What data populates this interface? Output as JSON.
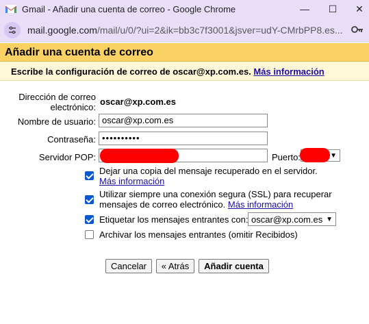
{
  "window": {
    "title": "Gmail - Añadir una cuenta de correo - Google Chrome",
    "minimize": "—",
    "maximize": "☐",
    "close": "✕"
  },
  "address_bar": {
    "host": "mail.google.com",
    "path": "/mail/u/0/?ui=2&ik=bb3c7f3001&jsver=udY-CMrbPP8.es..."
  },
  "dialog": {
    "title": "Añadir una cuenta de correo",
    "subtitle": "Escribe la configuración de correo de oscar@xp.com.es.",
    "more_info": "Más información"
  },
  "form": {
    "email_label": "Dirección de correo electrónico:",
    "email_value": "oscar@xp.com.es",
    "username_label": "Nombre de usuario:",
    "username_value": "oscar@xp.com.es",
    "password_label": "Contraseña:",
    "password_value": "••••••••••",
    "pop_label": "Servidor POP:",
    "port_label": "Puerto:",
    "opt_copy": "Dejar una copia del mensaje recuperado en el servidor.",
    "opt_copy_link": "Más información",
    "opt_ssl": "Utilizar siempre una conexión segura (SSL) para recuperar mensajes de correo electrónico.",
    "opt_ssl_link": "Más información",
    "opt_label": "Etiquetar los mensajes entrantes con:",
    "opt_label_value": "oscar@xp.com.es",
    "opt_archive": "Archivar los mensajes entrantes (omitir Recibidos)"
  },
  "buttons": {
    "cancel": "Cancelar",
    "back": "« Atrás",
    "add": "Añadir cuenta"
  },
  "colors": {
    "chrome": "#e8def8",
    "header": "#fad163",
    "checkbox": "#0b57d0",
    "redaction": "#ff0000"
  }
}
